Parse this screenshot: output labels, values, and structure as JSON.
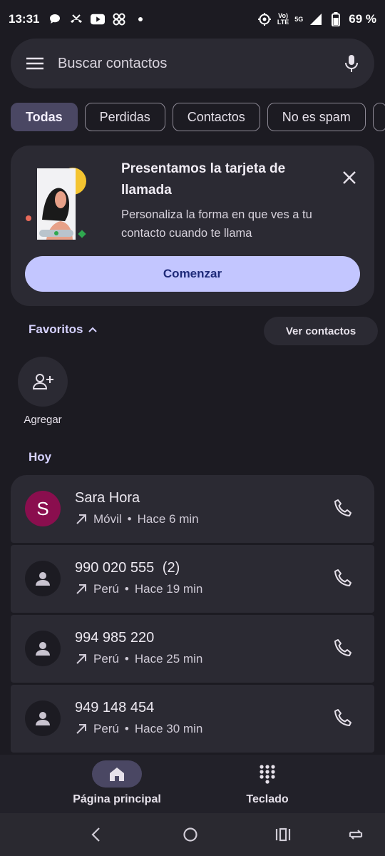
{
  "status": {
    "time": "13:31",
    "signal_top": "Vo)",
    "signal_bottom": "LTE",
    "net_top": "5G",
    "battery": "69 %"
  },
  "search": {
    "placeholder": "Buscar contactos"
  },
  "chips": [
    "Todas",
    "Perdidas",
    "Contactos",
    "No es spam"
  ],
  "promo": {
    "title": "Presentamos la tarjeta de llamada",
    "description": "Personaliza la forma en que ves a tu contacto cuando te llama",
    "cta": "Comenzar"
  },
  "favorites": {
    "header": "Favoritos",
    "see_contacts": "Ver contactos",
    "add_label": "Agregar"
  },
  "section_today": "Hoy",
  "calls": [
    {
      "name": "Sara Hora",
      "initial": "S",
      "type": "Móvil",
      "time": "Hace 6 min",
      "count": ""
    },
    {
      "name": "990 020 555",
      "initial": "",
      "type": "Perú",
      "time": "Hace 19 min",
      "count": "(2)"
    },
    {
      "name": "994 985 220",
      "initial": "",
      "type": "Perú",
      "time": "Hace 25 min",
      "count": ""
    },
    {
      "name": "949 148 454",
      "initial": "",
      "type": "Perú",
      "time": "Hace 30 min",
      "count": ""
    }
  ],
  "bottom_nav": {
    "home": "Página principal",
    "keypad": "Teclado"
  },
  "colors": {
    "background": "#1c1b22",
    "surface": "#2b2a33",
    "accent": "#c3c6ff",
    "avatar_s": "#8a0e4e"
  }
}
